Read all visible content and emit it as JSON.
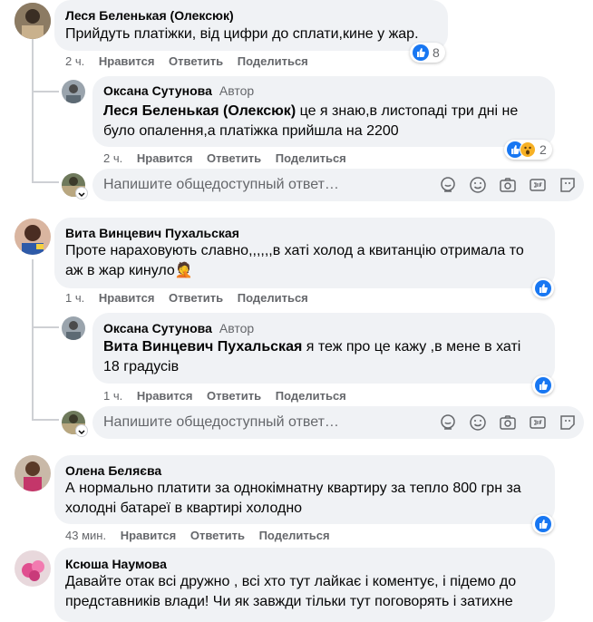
{
  "actions": {
    "like": "Нравится",
    "reply": "Ответить",
    "share": "Поделиться"
  },
  "reply_box": {
    "placeholder": "Напишите общедоступный ответ…"
  },
  "author_badge": "Автор",
  "comments": [
    {
      "name": "Леся Беленькая (Олексюк)",
      "text": "Прийдуть платіжки, від цифри до сплати,кине у жар.",
      "time": "2 ч.",
      "reactions": "8",
      "reply": {
        "name": "Оксана Сутунова",
        "mention": "Леся Беленькая (Олексюк)",
        "text_line1": " це я знаю,в листопаді три дні не",
        "text_line2": "було опалення,а платіжка прийшла на 2200",
        "time": "2 ч.",
        "reactions": "2"
      }
    },
    {
      "name": "Вита Винцевич Пухальская",
      "text_line1": "Проте нараховують славно,,,,,,в хаті холод а квитанцію отримала то",
      "text_line2": "аж в жар кинуло🤦",
      "time": "1 ч.",
      "reply": {
        "name": "Оксана Сутунова",
        "mention": "Вита Винцевич Пухальская",
        "text_line1": " я теж про це кажу ,в мене в хаті",
        "text_line2": "18 градусів",
        "time": "1 ч."
      }
    },
    {
      "name": "Олена Беляєва",
      "text_line1": "А нормально платити за однокімнатну квартиру за тепло 800 грн за",
      "text_line2": "холодні батареї в квартирі холодно",
      "time": "43 мин."
    },
    {
      "name": "Ксюша Наумова",
      "text_line1": "Давайте отак всі дружно , всі хто тут лайкає і коментує, і підемо до",
      "text_line2": "представників влади! Чи як завжди тільки тут поговорять і затихне"
    }
  ]
}
